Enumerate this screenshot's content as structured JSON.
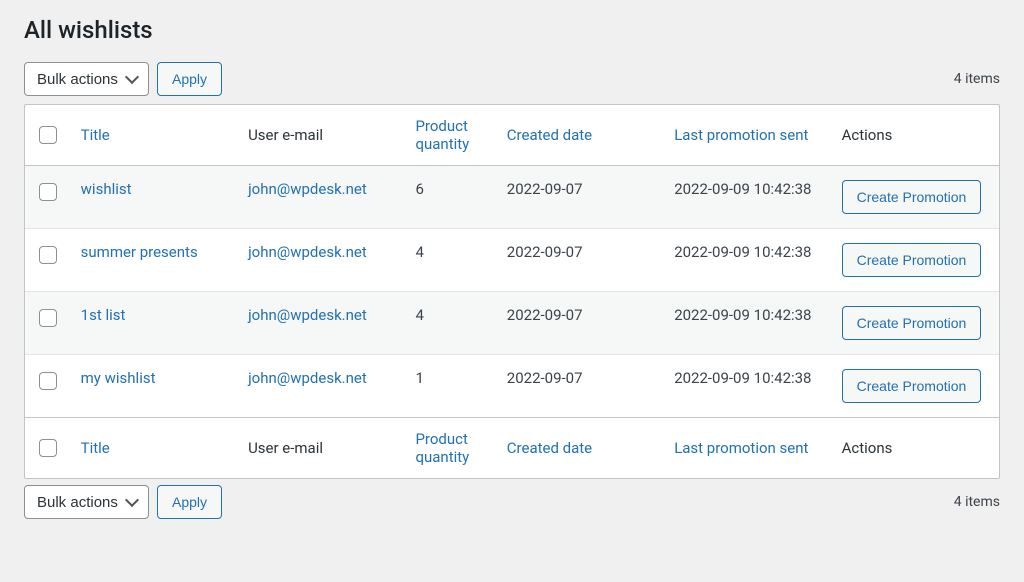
{
  "page": {
    "title": "All wishlists",
    "items_count_text": "4 items"
  },
  "bulk": {
    "select_label": "Bulk actions",
    "apply_label": "Apply"
  },
  "columns": {
    "title": "Title",
    "email": "User e-mail",
    "qty": "Product quantity",
    "created": "Created date",
    "last_sent": "Last promotion sent",
    "actions": "Actions"
  },
  "action_button_label": "Create Promotion",
  "rows": [
    {
      "title": "wishlist",
      "email": "john@wpdesk.net",
      "qty": "6",
      "created": "2022-09-07",
      "last_sent": "2022-09-09 10:42:38"
    },
    {
      "title": "summer presents",
      "email": "john@wpdesk.net",
      "qty": "4",
      "created": "2022-09-07",
      "last_sent": "2022-09-09 10:42:38"
    },
    {
      "title": "1st list",
      "email": "john@wpdesk.net",
      "qty": "4",
      "created": "2022-09-07",
      "last_sent": "2022-09-09 10:42:38"
    },
    {
      "title": "my wishlist",
      "email": "john@wpdesk.net",
      "qty": "1",
      "created": "2022-09-07",
      "last_sent": "2022-09-09 10:42:38"
    }
  ]
}
